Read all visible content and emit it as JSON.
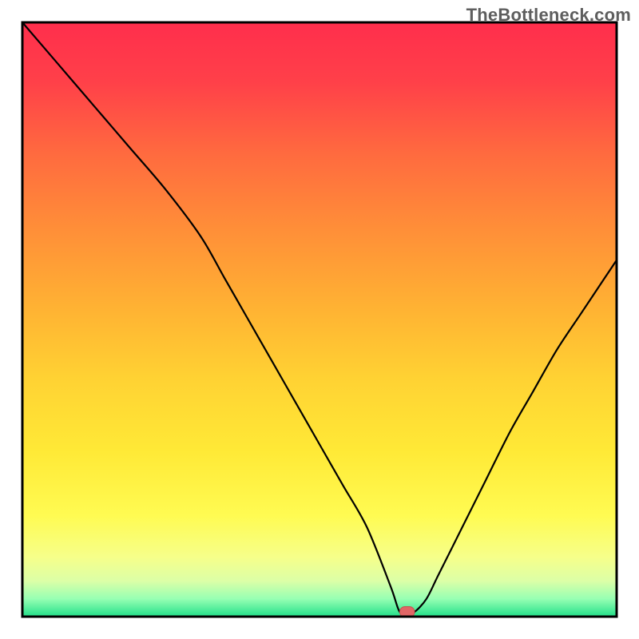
{
  "watermark": "TheBottleneck.com",
  "colors": {
    "curve": "#000000",
    "frame": "#000000",
    "marker_fill": "#e06666",
    "marker_stroke": "#c94f4f",
    "gradient_stops": [
      {
        "offset": 0.0,
        "color": "#ff2e4c"
      },
      {
        "offset": 0.1,
        "color": "#ff4049"
      },
      {
        "offset": 0.22,
        "color": "#ff6a3f"
      },
      {
        "offset": 0.35,
        "color": "#ff8f38"
      },
      {
        "offset": 0.48,
        "color": "#ffb233"
      },
      {
        "offset": 0.6,
        "color": "#ffd233"
      },
      {
        "offset": 0.72,
        "color": "#ffe936"
      },
      {
        "offset": 0.83,
        "color": "#fffb52"
      },
      {
        "offset": 0.9,
        "color": "#f6ff8a"
      },
      {
        "offset": 0.94,
        "color": "#dcffa7"
      },
      {
        "offset": 0.97,
        "color": "#97ffb3"
      },
      {
        "offset": 1.0,
        "color": "#22e08a"
      }
    ]
  },
  "chart_data": {
    "type": "line",
    "title": "",
    "xlabel": "",
    "ylabel": "",
    "xlim": [
      0,
      100
    ],
    "ylim": [
      0,
      100
    ],
    "note": "Background vertical gradient encodes bottleneck severity (top=red=high, bottom=green=low). Black V-curve shows bottleneck % vs. relative component performance. Values estimated from pixels.",
    "series": [
      {
        "name": "bottleneck_curve",
        "x": [
          0,
          6,
          12,
          18,
          24,
          30,
          34,
          38,
          42,
          46,
          50,
          54,
          58,
          62,
          63.5,
          65,
          66,
          68,
          70,
          74,
          78,
          82,
          86,
          90,
          94,
          98,
          100
        ],
        "y": [
          100,
          93,
          86,
          79,
          72,
          64,
          57,
          50,
          43,
          36,
          29,
          22,
          15,
          5,
          0.8,
          0.8,
          0.8,
          3,
          7,
          15,
          23,
          31,
          38,
          45,
          51,
          57,
          60
        ]
      }
    ],
    "marker": {
      "name": "optimal_point",
      "x_range": [
        63.5,
        66
      ],
      "y": 0.8,
      "shape": "rounded_rect"
    }
  }
}
